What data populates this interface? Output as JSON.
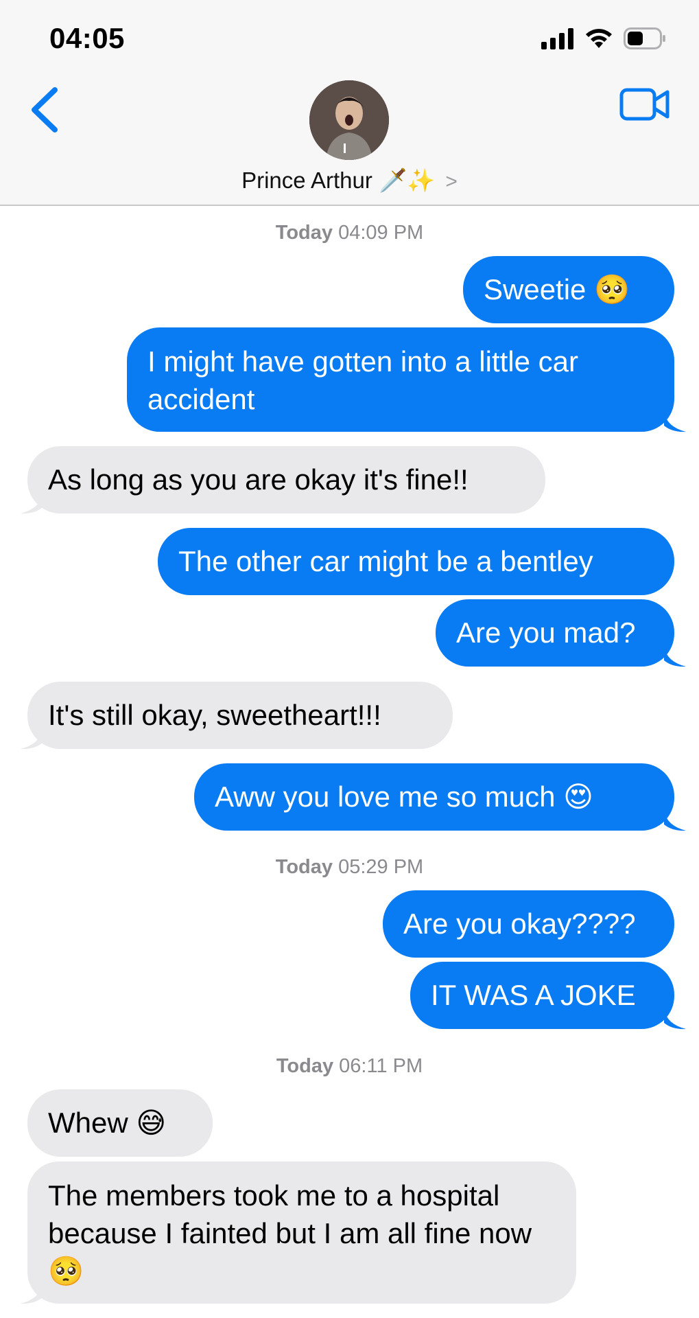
{
  "status_bar": {
    "time": "04:05"
  },
  "header": {
    "contact_name": "Prince Arthur",
    "contact_emoji": "🗡️✨",
    "chevron": ">"
  },
  "timestamps": [
    {
      "day": "Today",
      "time": "04:09 PM"
    },
    {
      "day": "Today",
      "time": "05:29 PM"
    },
    {
      "day": "Today",
      "time": "06:11 PM"
    }
  ],
  "messages": [
    {
      "from": "me",
      "text": "Sweetie 🥺"
    },
    {
      "from": "me",
      "text": "I might have gotten into a little car accident"
    },
    {
      "from": "them",
      "text": "As long as you are okay it's fine!!"
    },
    {
      "from": "me",
      "text": "The other car might be a bentley"
    },
    {
      "from": "me",
      "text": "Are you mad?"
    },
    {
      "from": "them",
      "text": "It's still okay, sweetheart!!!"
    },
    {
      "from": "me",
      "text": "Aww you love me so much 😍"
    },
    {
      "from": "me",
      "text": "Are you okay????"
    },
    {
      "from": "me",
      "text": "IT WAS A JOKE"
    },
    {
      "from": "them",
      "text": "Whew 😅"
    },
    {
      "from": "them",
      "text": "The members took me to a hospital because I fainted but I am all fine now 🥺"
    }
  ],
  "colors": {
    "sent_bubble": "#0a7cf3",
    "received_bubble": "#e9e9eb",
    "accent": "#0a7cf3"
  },
  "icons": [
    "signal-icon",
    "wifi-icon",
    "battery-icon",
    "back-chevron-icon",
    "video-camera-icon"
  ]
}
